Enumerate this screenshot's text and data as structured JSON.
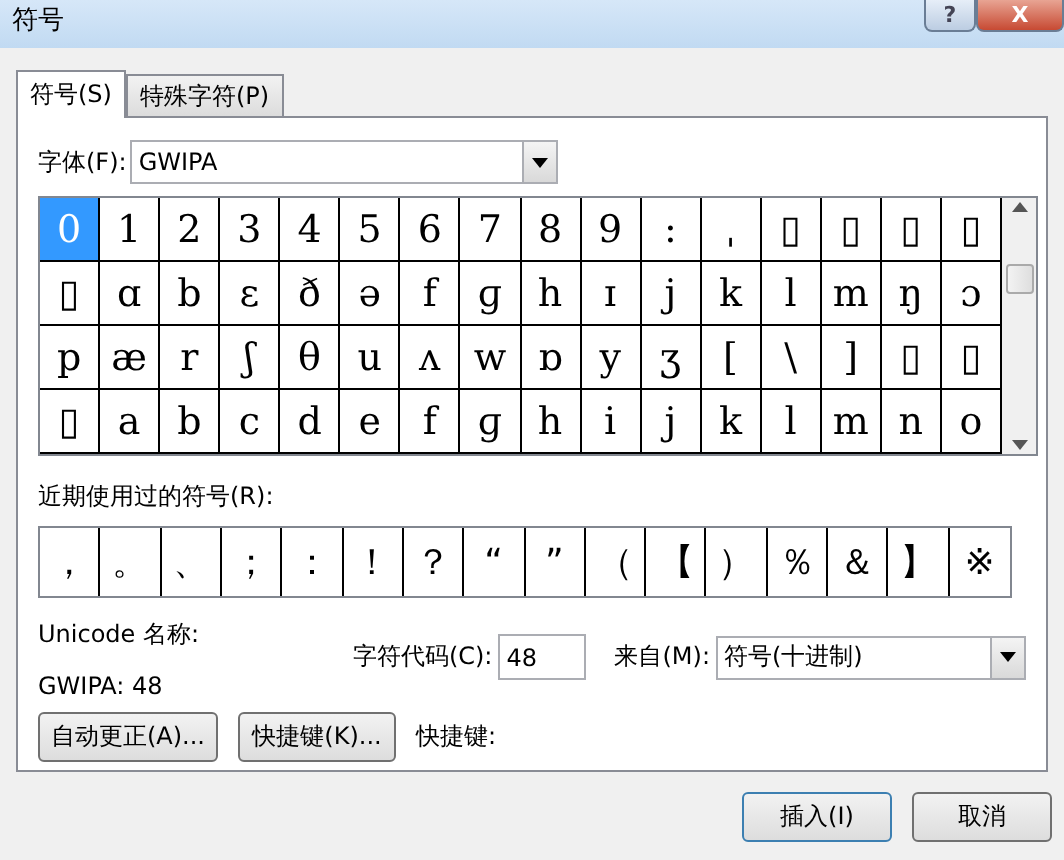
{
  "window": {
    "title": "符号",
    "buttons": [
      {
        "kind": "help",
        "label": "?"
      },
      {
        "kind": "close",
        "label": "X"
      }
    ]
  },
  "tabs": [
    {
      "label": "符号(S)",
      "selected": true
    },
    {
      "label": "特殊字符(P)",
      "selected": false
    }
  ],
  "font": {
    "label": "字体(F):",
    "value": "GWIPA"
  },
  "symbols": [
    {
      "row": [
        {
          "c": "0",
          "selected": true
        },
        {
          "c": "1",
          "selected": false
        },
        {
          "c": "2",
          "selected": false
        },
        {
          "c": "3",
          "selected": false
        },
        {
          "c": "4",
          "selected": false
        },
        {
          "c": "5",
          "selected": false
        },
        {
          "c": "6",
          "selected": false
        },
        {
          "c": "7",
          "selected": false
        },
        {
          "c": "8",
          "selected": false
        },
        {
          "c": "9",
          "selected": false
        },
        {
          "c": ":",
          "selected": false
        },
        {
          "c": "ˌ",
          "selected": false
        },
        {
          "c": "▯",
          "selected": false
        },
        {
          "c": "▯",
          "selected": false
        },
        {
          "c": "▯",
          "selected": false
        },
        {
          "c": "▯",
          "selected": false
        }
      ]
    },
    {
      "row": [
        {
          "c": "▯",
          "selected": false
        },
        {
          "c": "ɑ",
          "selected": false
        },
        {
          "c": "b",
          "selected": false
        },
        {
          "c": "ɛ",
          "selected": false
        },
        {
          "c": "ð",
          "selected": false
        },
        {
          "c": "ə",
          "selected": false
        },
        {
          "c": "f",
          "selected": false
        },
        {
          "c": "ɡ",
          "selected": false
        },
        {
          "c": "h",
          "selected": false
        },
        {
          "c": "ɪ",
          "selected": false
        },
        {
          "c": "j",
          "selected": false
        },
        {
          "c": "k",
          "selected": false
        },
        {
          "c": "l",
          "selected": false
        },
        {
          "c": "m",
          "selected": false
        },
        {
          "c": "ŋ",
          "selected": false
        },
        {
          "c": "ɔ",
          "selected": false
        }
      ]
    },
    {
      "row": [
        {
          "c": "p",
          "selected": false
        },
        {
          "c": "æ",
          "selected": false
        },
        {
          "c": "r",
          "selected": false
        },
        {
          "c": "ʃ",
          "selected": false
        },
        {
          "c": "θ",
          "selected": false
        },
        {
          "c": "u",
          "selected": false
        },
        {
          "c": "ʌ",
          "selected": false
        },
        {
          "c": "w",
          "selected": false
        },
        {
          "c": "ɒ",
          "selected": false
        },
        {
          "c": "y",
          "selected": false
        },
        {
          "c": "ʒ",
          "selected": false
        },
        {
          "c": "[",
          "selected": false
        },
        {
          "c": "\\",
          "selected": false
        },
        {
          "c": "]",
          "selected": false
        },
        {
          "c": "▯",
          "selected": false
        },
        {
          "c": "▯",
          "selected": false
        }
      ]
    },
    {
      "row": [
        {
          "c": "▯",
          "selected": false
        },
        {
          "c": "a",
          "selected": false
        },
        {
          "c": "b",
          "selected": false
        },
        {
          "c": "c",
          "selected": false
        },
        {
          "c": "d",
          "selected": false
        },
        {
          "c": "e",
          "selected": false
        },
        {
          "c": "f",
          "selected": false
        },
        {
          "c": "ɡ",
          "selected": false
        },
        {
          "c": "h",
          "selected": false
        },
        {
          "c": "i",
          "selected": false
        },
        {
          "c": "j",
          "selected": false
        },
        {
          "c": "k",
          "selected": false
        },
        {
          "c": "l",
          "selected": false
        },
        {
          "c": "m",
          "selected": false
        },
        {
          "c": "n",
          "selected": false
        },
        {
          "c": "o",
          "selected": false
        }
      ]
    }
  ],
  "recent": {
    "label": "近期使用过的符号(R):",
    "items": [
      "，",
      "。",
      "、",
      "；",
      "：",
      "！",
      "？",
      "“",
      "”",
      "（",
      "【",
      "）",
      "％",
      "＆",
      "】",
      "※"
    ]
  },
  "unicode_name": {
    "label": "Unicode 名称:",
    "value": "GWIPA: 48"
  },
  "char_code": {
    "label": "字符代码(C):",
    "value": "48"
  },
  "from": {
    "label": "来自(M):",
    "value": "符号(十进制)"
  },
  "action_buttons": [
    "自动更正(A)...",
    "快捷键(K)..."
  ],
  "shortcut_label": "快捷键:",
  "dialog_buttons": [
    {
      "label": "插入(I)",
      "default": true
    },
    {
      "label": "取消",
      "default": false
    }
  ]
}
